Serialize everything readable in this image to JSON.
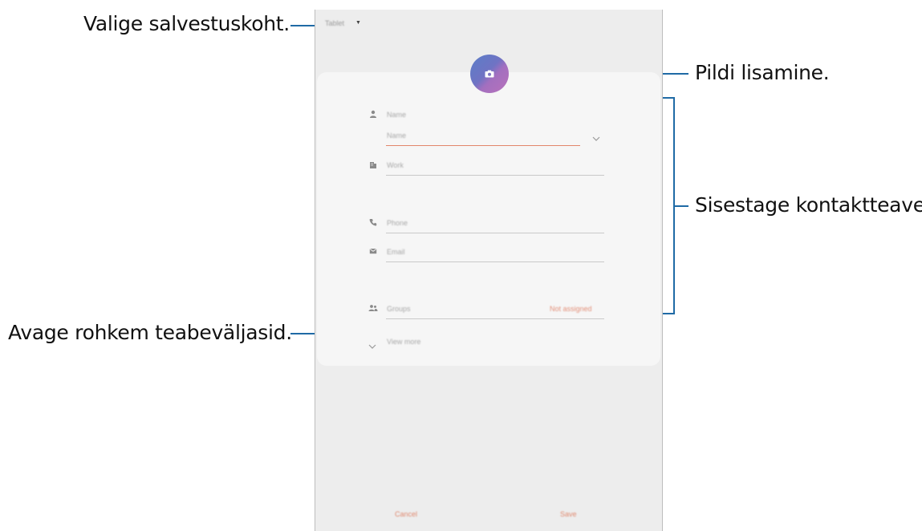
{
  "callouts": {
    "storage_location": "Valige salvestuskoht.",
    "add_picture": "Pildi lisamine.",
    "enter_contact_info": "Sisestage kontaktteave.",
    "open_more_fields": "Avage rohkem teabeväljasid."
  },
  "device": {
    "storage_selector": "Tablet",
    "fields": {
      "name_label": "Name",
      "name_input_placeholder": "Name",
      "work_label": "Work",
      "phone_label": "Phone",
      "email_label": "Email",
      "groups_label": "Groups",
      "groups_value": "Not assigned",
      "view_more": "View more"
    },
    "buttons": {
      "cancel": "Cancel",
      "save": "Save"
    }
  },
  "colors": {
    "callout_line": "#1f6aa5",
    "accent_orange": "#e2866a",
    "photo_gradient_start": "#5b7ec7",
    "photo_gradient_end": "#b872bb"
  }
}
